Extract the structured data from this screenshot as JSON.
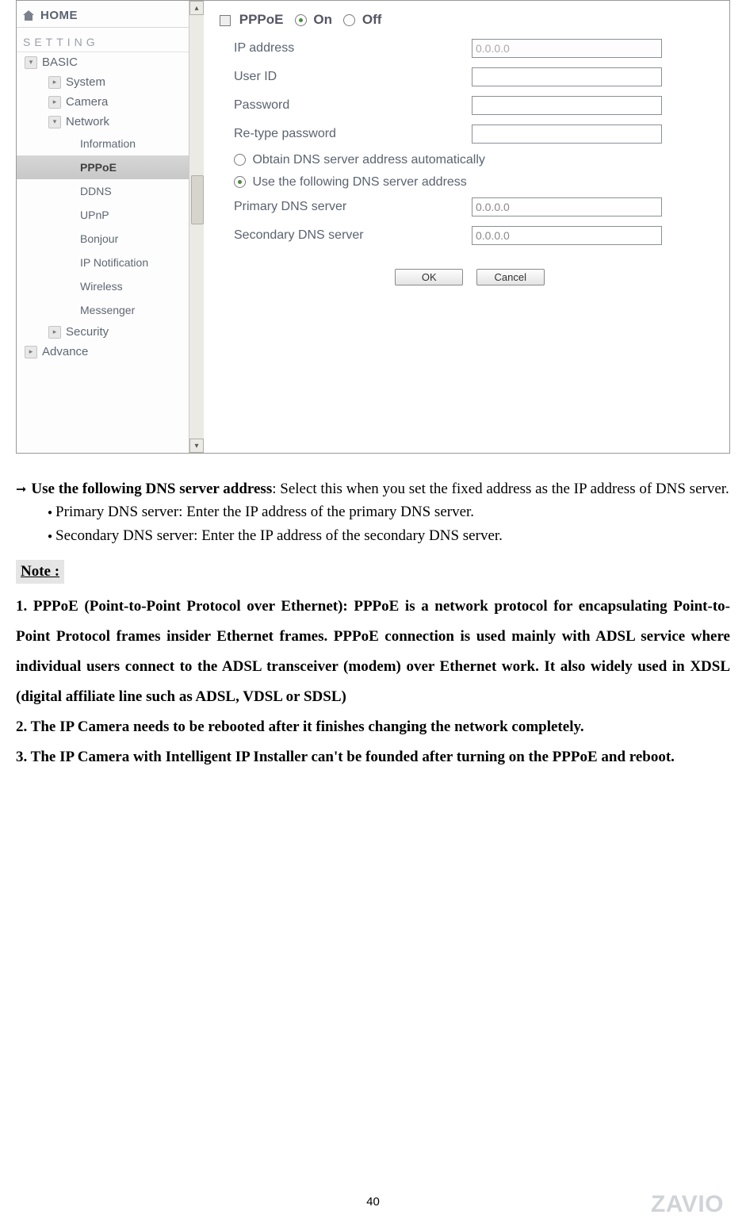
{
  "sidebar": {
    "home": "HOME",
    "setting_label": "SETTING",
    "basic_label": "BASIC",
    "items_l2": {
      "system": "System",
      "camera": "Camera",
      "network": "Network",
      "security": "Security"
    },
    "network_children": {
      "information": "Information",
      "pppoe": "PPPoE",
      "ddns": "DDNS",
      "upnp": "UPnP",
      "bonjour": "Bonjour",
      "ipnotif": "IP Notification",
      "wireless": "Wireless",
      "messenger": "Messenger"
    },
    "advance_label": "Advance"
  },
  "form": {
    "title": "PPPoE",
    "on": "On",
    "off": "Off",
    "ip_label": "IP address",
    "ip_value": "0.0.0.0",
    "userid_label": "User ID",
    "password_label": "Password",
    "retype_label": "Re-type password",
    "dns_auto": "Obtain DNS server address automatically",
    "dns_manual": "Use the following DNS server address",
    "primary_label": "Primary DNS server",
    "primary_value": "0.0.0.0",
    "secondary_label": "Secondary DNS server",
    "secondary_value": "0.0.0.0",
    "ok": "OK",
    "cancel": "Cancel"
  },
  "doc": {
    "para1_bold": "Use the following DNS server address",
    "para1_rest": ": Select this when you set the fixed address as the IP address of DNS server.",
    "bullet1": "Primary DNS server: Enter the IP address of the primary DNS server.",
    "bullet2": "Secondary DNS server: Enter the IP address of the secondary DNS server.",
    "note_label": "Note :",
    "note1": "1. PPPoE (Point-to-Point Protocol over Ethernet): PPPoE is a network protocol for encapsulating Point-to-Point Protocol frames insider Ethernet frames. PPPoE connection is used mainly with ADSL service where individual users connect to the ADSL transceiver (modem) over Ethernet work. It also widely used in XDSL (digital affiliate line such as ADSL, VDSL or SDSL)",
    "note2": "2. The IP Camera needs to be rebooted after it finishes changing the network completely.",
    "note3": "3. The IP Camera with Intelligent IP Installer can't be founded after turning on the PPPoE and reboot."
  },
  "page_number": "40",
  "watermark": "ZAVIO"
}
